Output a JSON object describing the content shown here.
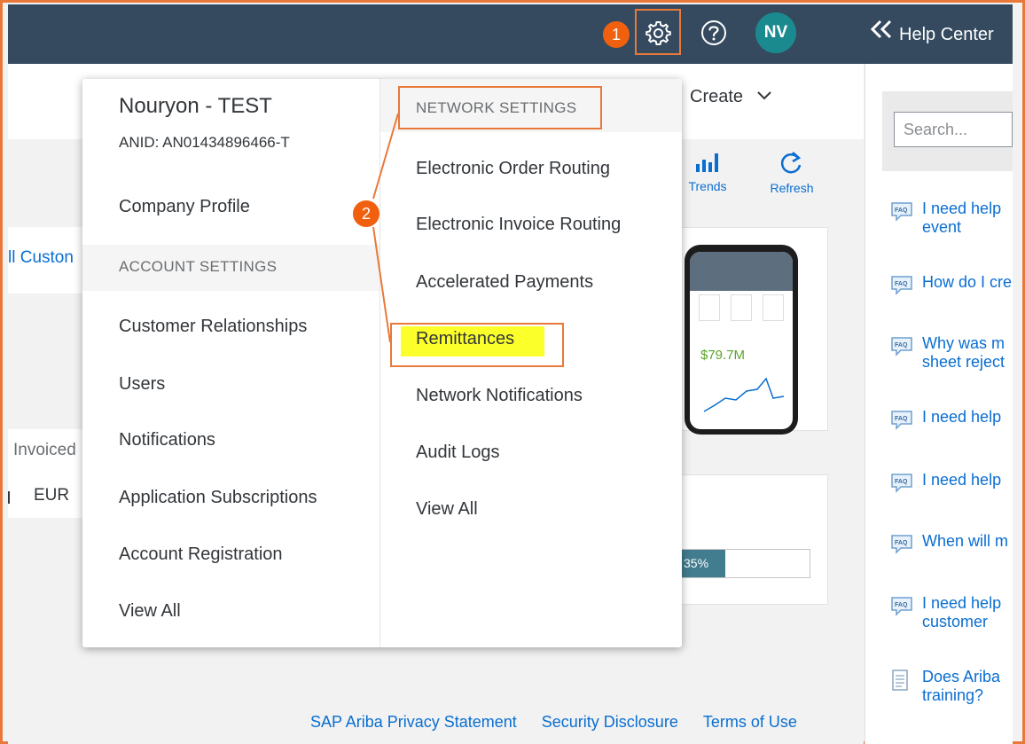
{
  "header": {
    "step1_badge": "1",
    "avatar_initials": "NV",
    "help_center_label": "Help Center"
  },
  "background": {
    "create_label": "Create",
    "trends_label": "Trends",
    "refresh_label": "Refresh",
    "left_link": "ll Custon",
    "left_column_header": "Invoiced",
    "left_currency": "EUR",
    "phone_amount": "$79.7M",
    "progress_label": "35%",
    "progress_value": 0.35
  },
  "menu": {
    "company_name": "Nouryon - TEST",
    "anid": "ANID: AN01434896466-T",
    "company_profile": "Company Profile",
    "account_settings_header": "ACCOUNT SETTINGS",
    "account_items": [
      "Customer Relationships",
      "Users",
      "Notifications",
      "Application Subscriptions",
      "Account Registration",
      "View All"
    ],
    "network_settings_header": "NETWORK SETTINGS",
    "network_items": [
      "Electronic Order Routing",
      "Electronic Invoice Routing",
      "Accelerated Payments",
      "Remittances",
      "Network Notifications",
      "Audit Logs",
      "View All"
    ],
    "step2_badge": "2"
  },
  "help_center": {
    "search_placeholder": "Search...",
    "items": [
      {
        "text": "I need help",
        "text2": "event",
        "icon": "faq-icon"
      },
      {
        "text": "How do I cre",
        "icon": "faq-icon"
      },
      {
        "text": "Why was m",
        "text2": "sheet reject",
        "icon": "faq-icon"
      },
      {
        "text": "I need help",
        "icon": "faq-icon"
      },
      {
        "text": "I need help",
        "icon": "faq-icon"
      },
      {
        "text": "When will m",
        "icon": "faq-icon"
      },
      {
        "text": "I need help",
        "text2": "customer",
        "icon": "faq-icon"
      },
      {
        "text": "Does Ariba",
        "text2": "training?",
        "icon": "document-icon"
      }
    ]
  },
  "footer": {
    "privacy": "SAP Ariba Privacy Statement",
    "security": "Security Disclosure",
    "terms": "Terms of Use"
  },
  "colors": {
    "topbar": "#354a5f",
    "callout_orange": "#e8793a",
    "badge_orange": "#f0600e",
    "link_blue": "#0a6ed1",
    "avatar_teal": "#1b8a8f",
    "highlight_yellow": "#fbff2a"
  }
}
